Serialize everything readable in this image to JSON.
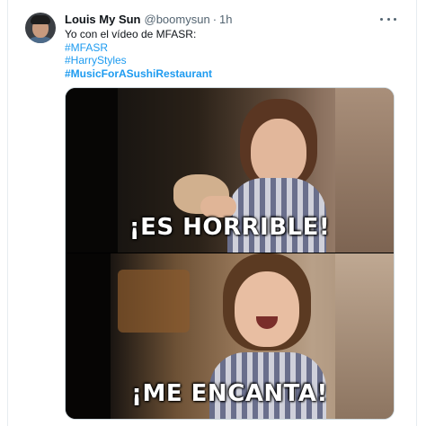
{
  "tweet": {
    "author": {
      "name": "Louis My Sun",
      "handle": "@boomysun",
      "separator": "·",
      "time": "1h"
    },
    "more_icon": "more-horizontal-icon",
    "text": "Yo con el vídeo de MFASR:",
    "hashtags": [
      "#MFASR",
      "#HarryStyles",
      "#MusicForASushiRestaurant"
    ],
    "media": {
      "caption_top": "¡ES HORRIBLE!",
      "caption_bottom": "¡ME ENCANTA!"
    }
  },
  "colors": {
    "text": "#0f1419",
    "secondary": "#536471",
    "link": "#1d9bf0",
    "border": "#cfd9de"
  }
}
